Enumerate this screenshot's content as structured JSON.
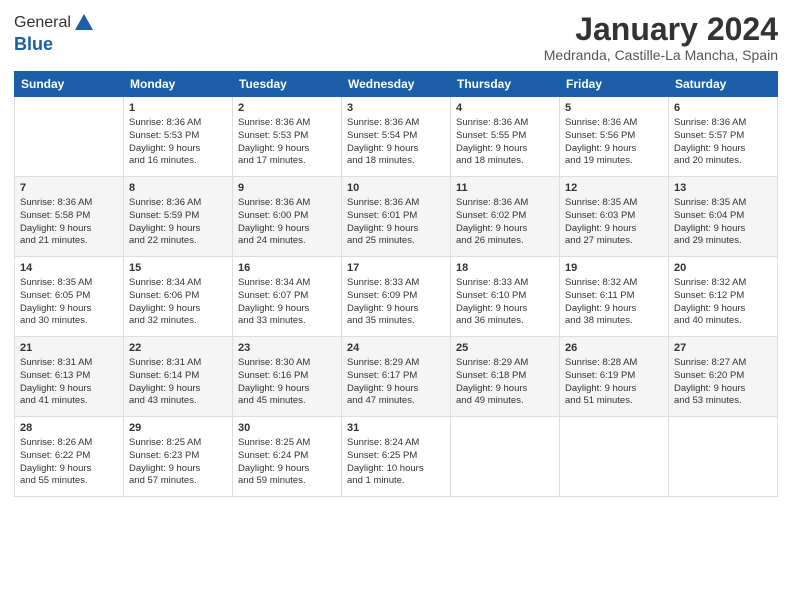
{
  "app": {
    "logo_line1": "General",
    "logo_line2": "Blue"
  },
  "header": {
    "month_year": "January 2024",
    "location": "Medranda, Castille-La Mancha, Spain"
  },
  "weekdays": [
    "Sunday",
    "Monday",
    "Tuesday",
    "Wednesday",
    "Thursday",
    "Friday",
    "Saturday"
  ],
  "weeks": [
    [
      {
        "day": "",
        "info": ""
      },
      {
        "day": "1",
        "info": "Sunrise: 8:36 AM\nSunset: 5:53 PM\nDaylight: 9 hours\nand 16 minutes."
      },
      {
        "day": "2",
        "info": "Sunrise: 8:36 AM\nSunset: 5:53 PM\nDaylight: 9 hours\nand 17 minutes."
      },
      {
        "day": "3",
        "info": "Sunrise: 8:36 AM\nSunset: 5:54 PM\nDaylight: 9 hours\nand 18 minutes."
      },
      {
        "day": "4",
        "info": "Sunrise: 8:36 AM\nSunset: 5:55 PM\nDaylight: 9 hours\nand 18 minutes."
      },
      {
        "day": "5",
        "info": "Sunrise: 8:36 AM\nSunset: 5:56 PM\nDaylight: 9 hours\nand 19 minutes."
      },
      {
        "day": "6",
        "info": "Sunrise: 8:36 AM\nSunset: 5:57 PM\nDaylight: 9 hours\nand 20 minutes."
      }
    ],
    [
      {
        "day": "7",
        "info": "Sunrise: 8:36 AM\nSunset: 5:58 PM\nDaylight: 9 hours\nand 21 minutes."
      },
      {
        "day": "8",
        "info": "Sunrise: 8:36 AM\nSunset: 5:59 PM\nDaylight: 9 hours\nand 22 minutes."
      },
      {
        "day": "9",
        "info": "Sunrise: 8:36 AM\nSunset: 6:00 PM\nDaylight: 9 hours\nand 24 minutes."
      },
      {
        "day": "10",
        "info": "Sunrise: 8:36 AM\nSunset: 6:01 PM\nDaylight: 9 hours\nand 25 minutes."
      },
      {
        "day": "11",
        "info": "Sunrise: 8:36 AM\nSunset: 6:02 PM\nDaylight: 9 hours\nand 26 minutes."
      },
      {
        "day": "12",
        "info": "Sunrise: 8:35 AM\nSunset: 6:03 PM\nDaylight: 9 hours\nand 27 minutes."
      },
      {
        "day": "13",
        "info": "Sunrise: 8:35 AM\nSunset: 6:04 PM\nDaylight: 9 hours\nand 29 minutes."
      }
    ],
    [
      {
        "day": "14",
        "info": "Sunrise: 8:35 AM\nSunset: 6:05 PM\nDaylight: 9 hours\nand 30 minutes."
      },
      {
        "day": "15",
        "info": "Sunrise: 8:34 AM\nSunset: 6:06 PM\nDaylight: 9 hours\nand 32 minutes."
      },
      {
        "day": "16",
        "info": "Sunrise: 8:34 AM\nSunset: 6:07 PM\nDaylight: 9 hours\nand 33 minutes."
      },
      {
        "day": "17",
        "info": "Sunrise: 8:33 AM\nSunset: 6:09 PM\nDaylight: 9 hours\nand 35 minutes."
      },
      {
        "day": "18",
        "info": "Sunrise: 8:33 AM\nSunset: 6:10 PM\nDaylight: 9 hours\nand 36 minutes."
      },
      {
        "day": "19",
        "info": "Sunrise: 8:32 AM\nSunset: 6:11 PM\nDaylight: 9 hours\nand 38 minutes."
      },
      {
        "day": "20",
        "info": "Sunrise: 8:32 AM\nSunset: 6:12 PM\nDaylight: 9 hours\nand 40 minutes."
      }
    ],
    [
      {
        "day": "21",
        "info": "Sunrise: 8:31 AM\nSunset: 6:13 PM\nDaylight: 9 hours\nand 41 minutes."
      },
      {
        "day": "22",
        "info": "Sunrise: 8:31 AM\nSunset: 6:14 PM\nDaylight: 9 hours\nand 43 minutes."
      },
      {
        "day": "23",
        "info": "Sunrise: 8:30 AM\nSunset: 6:16 PM\nDaylight: 9 hours\nand 45 minutes."
      },
      {
        "day": "24",
        "info": "Sunrise: 8:29 AM\nSunset: 6:17 PM\nDaylight: 9 hours\nand 47 minutes."
      },
      {
        "day": "25",
        "info": "Sunrise: 8:29 AM\nSunset: 6:18 PM\nDaylight: 9 hours\nand 49 minutes."
      },
      {
        "day": "26",
        "info": "Sunrise: 8:28 AM\nSunset: 6:19 PM\nDaylight: 9 hours\nand 51 minutes."
      },
      {
        "day": "27",
        "info": "Sunrise: 8:27 AM\nSunset: 6:20 PM\nDaylight: 9 hours\nand 53 minutes."
      }
    ],
    [
      {
        "day": "28",
        "info": "Sunrise: 8:26 AM\nSunset: 6:22 PM\nDaylight: 9 hours\nand 55 minutes."
      },
      {
        "day": "29",
        "info": "Sunrise: 8:25 AM\nSunset: 6:23 PM\nDaylight: 9 hours\nand 57 minutes."
      },
      {
        "day": "30",
        "info": "Sunrise: 8:25 AM\nSunset: 6:24 PM\nDaylight: 9 hours\nand 59 minutes."
      },
      {
        "day": "31",
        "info": "Sunrise: 8:24 AM\nSunset: 6:25 PM\nDaylight: 10 hours\nand 1 minute."
      },
      {
        "day": "",
        "info": ""
      },
      {
        "day": "",
        "info": ""
      },
      {
        "day": "",
        "info": ""
      }
    ]
  ]
}
